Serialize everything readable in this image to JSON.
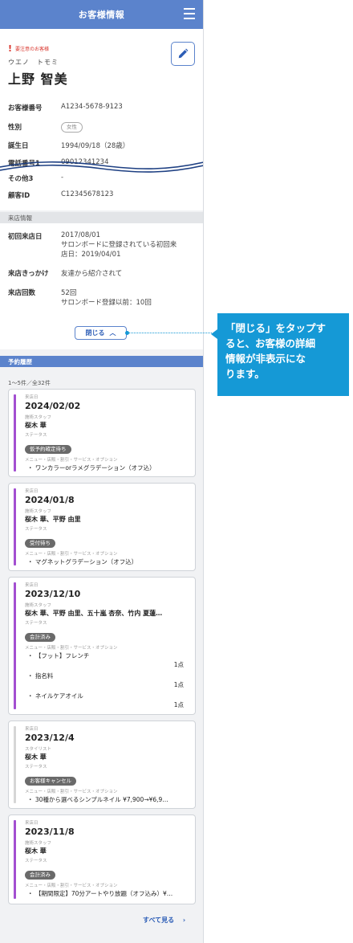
{
  "header": {
    "title": "お客様情報"
  },
  "profile": {
    "warning": "要注意のお客様",
    "kana": "ウエノ　トモミ",
    "name": "上野 智美",
    "fields": [
      {
        "label": "お客様番号",
        "value": "A1234-5678-9123"
      },
      {
        "label": "性別",
        "value": "女性"
      },
      {
        "label": "誕生日",
        "value": "1994/09/18（28歳）"
      },
      {
        "label": "電話番号1",
        "value": "09012341234"
      },
      {
        "label": "その他3",
        "value": "-"
      },
      {
        "label": "顧客ID",
        "value": "C12345678123"
      }
    ]
  },
  "visit_info": {
    "section_title": "来店情報",
    "first_visit_label": "初回来店日",
    "first_visit_lines": [
      "2017/08/01",
      "サロンボードに登録されている初回来",
      "店日：2019/04/01"
    ],
    "trigger_label": "来店きっかけ",
    "trigger_value": "友達から紹介されて",
    "count_label": "来店回数",
    "count_lines": [
      "52回",
      "サロンボード登録以前：10回"
    ]
  },
  "close_button": {
    "label": "閉じる"
  },
  "reservations": {
    "section_title": "予約履歴",
    "count_text": "1～5件／全32件",
    "labels": {
      "date": "来店日",
      "staff": "施術スタッフ",
      "stylist": "スタイリスト",
      "status": "ステータス",
      "menu": "メニュー・店販・割引・サービス・オプション"
    },
    "cards": [
      {
        "date": "2024/02/02",
        "staff": "桜木 華",
        "status": "仮予約確定待ち",
        "menus": [
          "・ ワンカラーorラメグラデーション（オフ込）"
        ],
        "bar_color": "#a34fd1"
      },
      {
        "date": "2024/01/8",
        "staff": "桜木 華、平野 由里",
        "status": "受付待ち",
        "menus": [
          "・ マグネットグラデーション（オフ込）"
        ],
        "bar_color": "#a34fd1"
      },
      {
        "date": "2023/12/10",
        "staff": "桜木 華、平野 由里、五十嵐 杏奈、竹内 夏蓮…",
        "status": "会計済み",
        "menus": [
          "・ 【フット】フレンチ",
          "1点",
          "・ 指名料",
          "1点",
          "・ ネイルケアオイル",
          "1点"
        ],
        "bar_color": "#a34fd1"
      },
      {
        "date": "2023/12/4",
        "staff": "桜木 華",
        "status": "お客様キャンセル",
        "menus": [
          "・ 30種から選べるシンプルネイル ¥7,900→¥6,9…"
        ],
        "bar_color": "#d6d6d6"
      },
      {
        "date": "2023/11/8",
        "staff": "桜木 華",
        "status": "会計済み",
        "menus": [
          "・ 【期間限定】70分アートやり放題（オフ込み）¥…"
        ],
        "bar_color": "#a34fd1"
      }
    ],
    "all_link": "すべて見る"
  },
  "callout": {
    "lines": [
      "「閉じる」をタップす",
      "ると、お客様の詳細",
      "情報が非表示にな",
      "ります。"
    ]
  },
  "colors": {
    "header": "#5b83cc",
    "accent": "#2c5db6",
    "callout": "#1599d6",
    "bar_active": "#a34fd1"
  }
}
